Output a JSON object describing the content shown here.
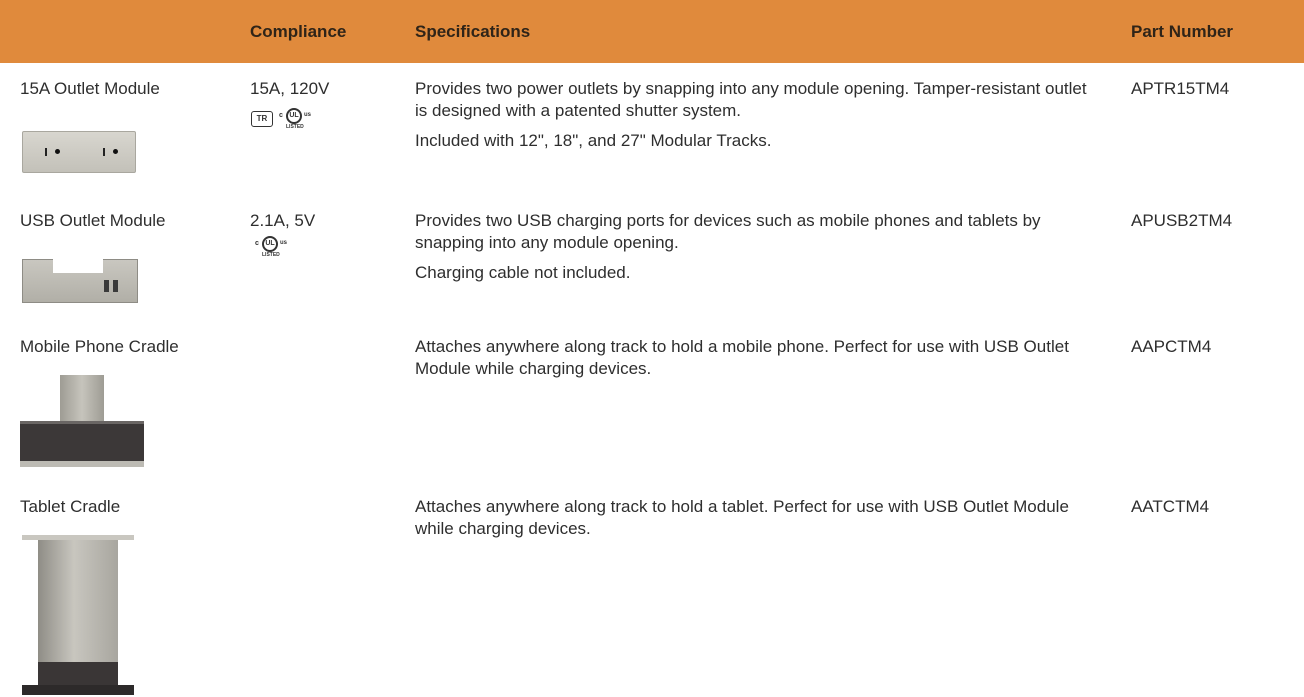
{
  "header": {
    "compliance": "Compliance",
    "specifications": "Specifications",
    "part_number": "Part Number"
  },
  "rows": [
    {
      "name": "15A Outlet Module",
      "compliance": "15A, 120V",
      "spec": [
        "Provides two power outlets by snapping into any module opening. Tamper-resistant outlet is designed with a patented shutter system.",
        "Included with 12\", 18\", and 27\" Modular Tracks."
      ],
      "part": "APTR15TM4",
      "cert_icons": [
        "tr-tamper-resistant-icon",
        "etl-listed-icon"
      ]
    },
    {
      "name": "USB Outlet Module",
      "compliance": "2.1A, 5V",
      "spec": [
        "Provides two USB charging ports for devices such as mobile phones and tablets by snapping into any module opening.",
        "Charging cable not included."
      ],
      "part": "APUSB2TM4",
      "cert_icons": [
        "etl-listed-icon"
      ]
    },
    {
      "name": "Mobile Phone Cradle",
      "compliance": "",
      "spec": [
        "Attaches anywhere along track to hold a mobile phone. Perfect for use with USB Outlet Module while charging devices."
      ],
      "part": "AAPCTM4"
    },
    {
      "name": "Tablet Cradle",
      "compliance": "",
      "spec": [
        "Attaches anywhere along track to hold a tablet. Perfect for use with USB Outlet Module while charging devices."
      ],
      "part": "AATCTM4"
    }
  ],
  "marks": {
    "tr": "TR",
    "c": "c",
    "ul": "UL",
    "us": "us",
    "listed": "LISTED"
  },
  "colors": {
    "header_bg": "#e08a3c"
  }
}
